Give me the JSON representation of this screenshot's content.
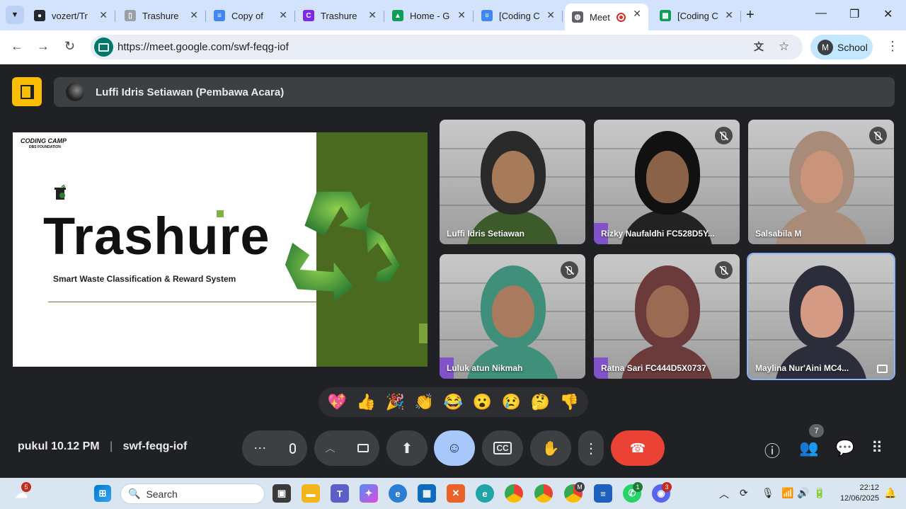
{
  "browser": {
    "tabs": [
      {
        "label": "vozert/Tr",
        "icon": "github-icon",
        "color": "#24292f",
        "active": false
      },
      {
        "label": "Trashure",
        "icon": "trash-icon",
        "color": "#9aa0a6",
        "active": false
      },
      {
        "label": "Copy of",
        "icon": "docs-icon",
        "color": "#4285f4",
        "active": false
      },
      {
        "label": "Trashure",
        "icon": "canva-icon",
        "color": "#7d2ae8",
        "active": false
      },
      {
        "label": "Home - G",
        "icon": "drive-icon",
        "color": "#0f9d58",
        "active": false
      },
      {
        "label": "[Coding C",
        "icon": "docs-icon",
        "color": "#4285f4",
        "active": false
      },
      {
        "label": "Meet",
        "icon": "globe-icon",
        "color": "#5f6368",
        "active": true
      },
      {
        "label": "[Coding C",
        "icon": "sheets-icon",
        "color": "#0f9d58",
        "active": false
      }
    ],
    "new_tab": "+",
    "url": "https://meet.google.com/swf-feqg-iof",
    "profile": {
      "initial": "M",
      "label": "School"
    }
  },
  "meet": {
    "presenter": "Luffi Idris Setiawan (Pembawa Acara)",
    "slide": {
      "logo": "CODING CAMP",
      "logo_sub": "DBS FOUNDATION",
      "title": "Trashure",
      "subtitle": "Smart Waste Classification & Reward System"
    },
    "participants": [
      {
        "name": "Luffi Idris Setiawan",
        "muted": false,
        "hair": "#2a2a2a",
        "skin": "#a77b5a",
        "shirt": "#3d5a2a"
      },
      {
        "name": "Rizky Naufaldhi FC528D5Y...",
        "muted": true,
        "hair": "#111111",
        "skin": "#8a6248",
        "shirt": "#222222"
      },
      {
        "name": "Salsabila M",
        "muted": true,
        "hair": "#a98b7a",
        "skin": "#c9947a",
        "shirt": "#a98b7a"
      },
      {
        "name": "Luluk atun Nikmah",
        "muted": true,
        "hair": "#3f8f7a",
        "skin": "#a97a5e",
        "shirt": "#3f8f7a"
      },
      {
        "name": "Ratna Sari FC444D5X0737",
        "muted": true,
        "hair": "#6b3a3a",
        "skin": "#9a6b52",
        "shirt": "#6b3a3a"
      },
      {
        "name": "Maylina Nur'Aini MC4...",
        "muted": false,
        "hair": "#2b2d3a",
        "skin": "#d49a84",
        "shirt": "#2b2d3a"
      }
    ],
    "reactions": [
      "💖",
      "👍",
      "🎉",
      "👏",
      "😂",
      "😮",
      "😢",
      "🤔",
      "👎"
    ],
    "time_label": "pukul 10.12 PM",
    "separator": "|",
    "meeting_code": "swf-feqg-iof",
    "people_count": "7"
  },
  "taskbar": {
    "search_placeholder": "Search",
    "weather_badge": "5",
    "whatsapp_badge": "1",
    "discord_badge": "3",
    "chrome_badge": "M",
    "time": "22:12",
    "date": "12/06/2025"
  }
}
